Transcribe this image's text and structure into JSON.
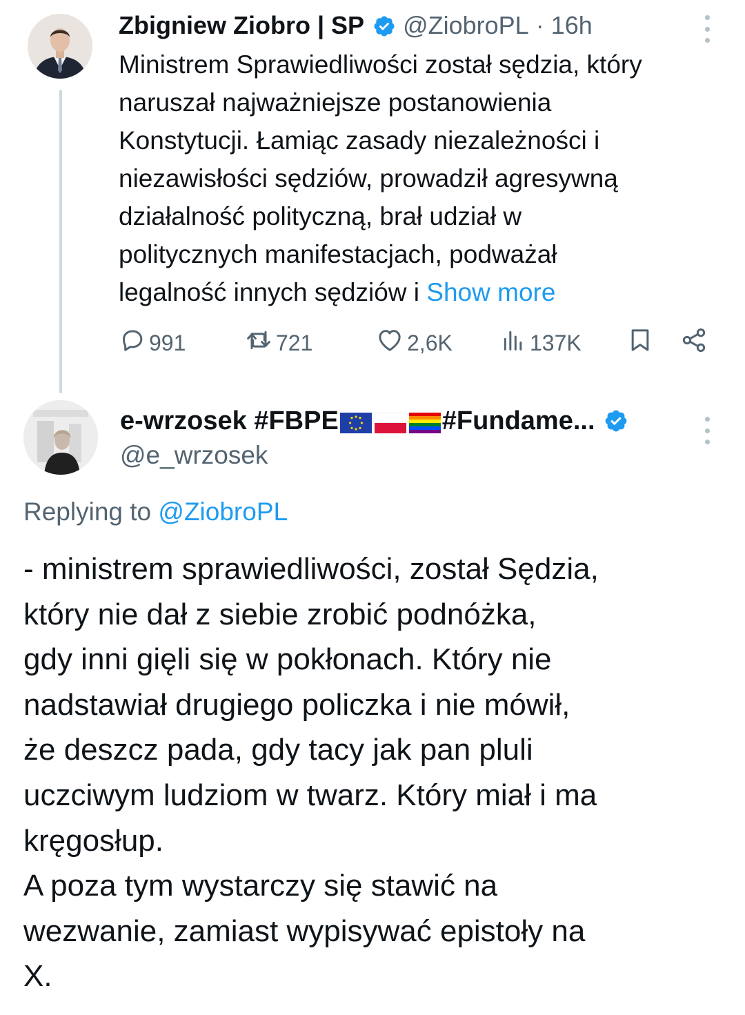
{
  "tweet1": {
    "author_name": "Zbigniew Ziobro | SP",
    "handle": "@ZiobroPL",
    "separator": "·",
    "time": "16h",
    "text_lines": [
      "Ministrem Sprawiedliwości został sędzia, który",
      "naruszał najważniejsze postanowienia",
      "Konstytucji. Łamiąc zasady niezależności i",
      "niezawisłości sędziów, prowadził agresywną",
      "działalność polityczną, brał udział w",
      "politycznych manifestacjach, podważał",
      "legalność innych sędziów i"
    ],
    "show_more": "Show more",
    "stats": {
      "replies": "991",
      "reposts": "721",
      "likes": "2,6K",
      "views": "137K"
    },
    "icons": [
      "verified-badge-icon",
      "more-icon",
      "reply-icon",
      "repost-icon",
      "like-icon",
      "views-icon",
      "bookmark-icon",
      "share-icon"
    ]
  },
  "tweet2": {
    "author_name_prefix": "e-wrzosek #FBPE",
    "author_name_suffix": "#Fundame...",
    "flags": [
      "eu-flag-icon",
      "poland-flag-icon",
      "rainbow-flag-icon"
    ],
    "handle": "@e_wrzosek",
    "replying_prefix": "Replying to",
    "replying_mention": "@ZiobroPL",
    "text_lines": [
      "- ministrem sprawiedliwości, został Sędzia,",
      "który nie dał z siebie zrobić podnóżka,",
      "gdy inni gięli się w pokłonach. Który nie",
      "nadstawiał drugiego policzka i nie mówił,",
      "że deszcz pada, gdy tacy jak pan pluli",
      "uczciwym ludziom w twarz. Który miał i ma",
      "kręgosłup.",
      "A poza tym wystarczy się stawić na",
      "wezwanie, zamiast wypisywać epistoły na",
      "X."
    ]
  },
  "colors": {
    "text": "#0f1419",
    "secondary": "#536471",
    "accent": "#1d9bf0",
    "thread_line": "#cfd9de"
  }
}
